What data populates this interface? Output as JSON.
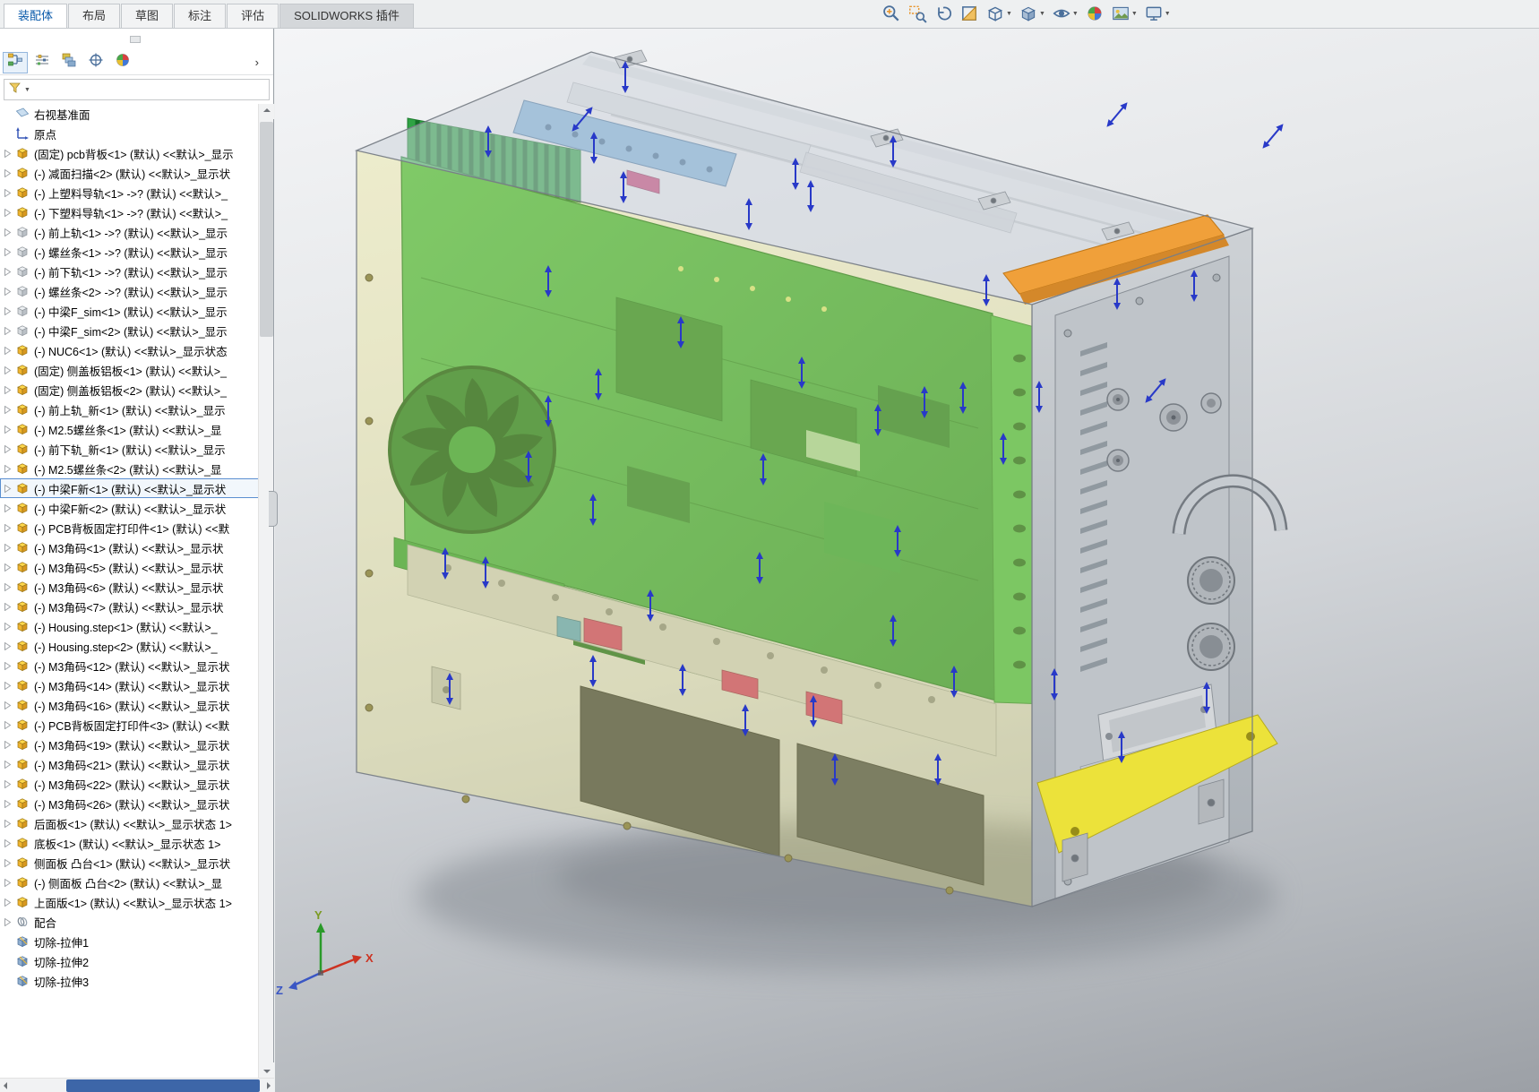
{
  "ribbon": {
    "tabs": [
      {
        "label": "装配体",
        "active": true
      },
      {
        "label": "布局"
      },
      {
        "label": "草图"
      },
      {
        "label": "标注"
      },
      {
        "label": "评估"
      },
      {
        "label": "SOLIDWORKS 插件",
        "addin": true
      }
    ]
  },
  "headsup_toolbar": {
    "buttons": [
      {
        "name": "zoom-to-fit"
      },
      {
        "name": "zoom-area"
      },
      {
        "name": "previous-view"
      },
      {
        "name": "section-view"
      },
      {
        "name": "view-orientation",
        "dropdown": true
      },
      {
        "name": "display-style",
        "dropdown": true
      },
      {
        "name": "hide-show-items",
        "dropdown": true
      },
      {
        "name": "edit-appearance"
      },
      {
        "name": "apply-scene",
        "dropdown": true
      },
      {
        "name": "view-settings",
        "dropdown": true
      }
    ]
  },
  "left_panel": {
    "tabs": [
      {
        "name": "featuremanager-design-tree",
        "active": true
      },
      {
        "name": "propertymanager"
      },
      {
        "name": "configurationmanager"
      },
      {
        "name": "dimxpertmanager"
      },
      {
        "name": "display-manager-appearances"
      }
    ],
    "overflow_chevron": "›"
  },
  "feature_tree": {
    "items": [
      {
        "icon": "plane",
        "label": "右视基准面",
        "expander": false
      },
      {
        "icon": "origin",
        "label": "原点",
        "expander": false
      },
      {
        "icon": "part",
        "label": "(固定) pcb背板<1> (默认) <<默认>_显示",
        "expander": true
      },
      {
        "icon": "part",
        "label": "(-) 减面扫描<2> (默认) <<默认>_显示状",
        "expander": true
      },
      {
        "icon": "part",
        "label": "(-) 上塑料导轨<1> ->? (默认) <<默认>_",
        "expander": true
      },
      {
        "icon": "part",
        "label": "(-) 下塑料导轨<1> ->? (默认) <<默认>_",
        "expander": true
      },
      {
        "icon": "part-gray",
        "label": "(-) 前上轨<1> ->? (默认) <<默认>_显示",
        "expander": true
      },
      {
        "icon": "part-gray",
        "label": "(-) 螺丝条<1> ->? (默认) <<默认>_显示",
        "expander": true
      },
      {
        "icon": "part-gray",
        "label": "(-) 前下轨<1> ->? (默认) <<默认>_显示",
        "expander": true
      },
      {
        "icon": "part-gray",
        "label": "(-) 螺丝条<2> ->? (默认) <<默认>_显示",
        "expander": true
      },
      {
        "icon": "part-gray",
        "label": "(-) 中梁F_sim<1> (默认) <<默认>_显示",
        "expander": true
      },
      {
        "icon": "part-gray",
        "label": "(-) 中梁F_sim<2> (默认) <<默认>_显示",
        "expander": true
      },
      {
        "icon": "part",
        "label": "(-) NUC6<1> (默认) <<默认>_显示状态",
        "expander": true
      },
      {
        "icon": "part",
        "label": "(固定) 侧盖板铝板<1> (默认) <<默认>_",
        "expander": true
      },
      {
        "icon": "part",
        "label": "(固定) 侧盖板铝板<2> (默认) <<默认>_",
        "expander": true
      },
      {
        "icon": "part",
        "label": "(-) 前上轨_新<1> (默认) <<默认>_显示",
        "expander": true
      },
      {
        "icon": "part",
        "label": "(-) M2.5螺丝条<1> (默认) <<默认>_显",
        "expander": true
      },
      {
        "icon": "part",
        "label": "(-) 前下轨_新<1> (默认) <<默认>_显示",
        "expander": true
      },
      {
        "icon": "part",
        "label": "(-) M2.5螺丝条<2> (默认) <<默认>_显",
        "expander": true
      },
      {
        "icon": "part",
        "label": "(-) 中梁F新<1> (默认) <<默认>_显示状",
        "expander": true,
        "selected": true
      },
      {
        "icon": "part",
        "label": "(-) 中梁F新<2> (默认) <<默认>_显示状",
        "expander": true
      },
      {
        "icon": "part",
        "label": "(-) PCB背板固定打印件<1> (默认) <<默",
        "expander": true
      },
      {
        "icon": "part",
        "label": "(-) M3角码<1> (默认) <<默认>_显示状",
        "expander": true
      },
      {
        "icon": "part",
        "label": "(-) M3角码<5> (默认) <<默认>_显示状",
        "expander": true
      },
      {
        "icon": "part",
        "label": "(-) M3角码<6> (默认) <<默认>_显示状",
        "expander": true
      },
      {
        "icon": "part",
        "label": "(-) M3角码<7> (默认) <<默认>_显示状",
        "expander": true
      },
      {
        "icon": "part",
        "label": "(-) Housing.step<1> (默认) <<默认>_",
        "expander": true
      },
      {
        "icon": "part",
        "label": "(-) Housing.step<2> (默认) <<默认>_",
        "expander": true
      },
      {
        "icon": "part",
        "label": "(-) M3角码<12> (默认) <<默认>_显示状",
        "expander": true
      },
      {
        "icon": "part",
        "label": "(-) M3角码<14> (默认) <<默认>_显示状",
        "expander": true
      },
      {
        "icon": "part",
        "label": "(-) M3角码<16> (默认) <<默认>_显示状",
        "expander": true
      },
      {
        "icon": "part",
        "label": "(-) PCB背板固定打印件<3> (默认) <<默",
        "expander": true
      },
      {
        "icon": "part",
        "label": "(-) M3角码<19> (默认) <<默认>_显示状",
        "expander": true
      },
      {
        "icon": "part",
        "label": "(-) M3角码<21> (默认) <<默认>_显示状",
        "expander": true
      },
      {
        "icon": "part",
        "label": "(-) M3角码<22> (默认) <<默认>_显示状",
        "expander": true
      },
      {
        "icon": "part",
        "label": "(-) M3角码<26> (默认) <<默认>_显示状",
        "expander": true
      },
      {
        "icon": "part",
        "label": "后面板<1> (默认) <<默认>_显示状态 1>",
        "expander": true
      },
      {
        "icon": "part",
        "label": "底板<1> (默认) <<默认>_显示状态 1>",
        "expander": true
      },
      {
        "icon": "part",
        "label": "侧面板 凸台<1> (默认) <<默认>_显示状",
        "expander": true
      },
      {
        "icon": "part",
        "label": "(-) 侧面板 凸台<2> (默认) <<默认>_显",
        "expander": true
      },
      {
        "icon": "part",
        "label": "上面版<1> (默认) <<默认>_显示状态 1>",
        "expander": true
      },
      {
        "icon": "mates",
        "label": "配合",
        "expander": true
      },
      {
        "icon": "cut",
        "label": "切除-拉伸1",
        "expander": false
      },
      {
        "icon": "cut",
        "label": "切除-拉伸2",
        "expander": false
      },
      {
        "icon": "cut",
        "label": "切除-拉伸3",
        "expander": false
      }
    ]
  },
  "viewport": {
    "triad": {
      "x": "X",
      "y": "Y",
      "z": "Z"
    }
  },
  "colors": {
    "selection_blue": "#5a8fd0",
    "arrow_blue": "#2839c8",
    "pcb_green": "#35a845",
    "housing_yellow": "#e9e37f",
    "rail_orange": "#f0a03a",
    "accent_magenta": "#c63f72",
    "bottom_plate_yellow": "#ece23a"
  }
}
